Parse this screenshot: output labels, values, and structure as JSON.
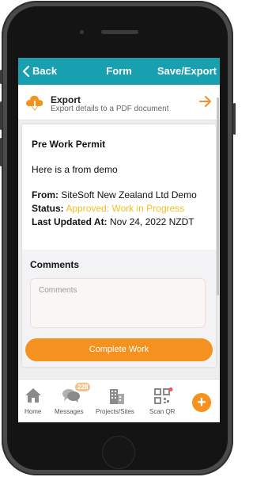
{
  "header": {
    "back_label": "Back",
    "title": "Form",
    "save_label": "Save/Export"
  },
  "export": {
    "title": "Export",
    "subtitle": "Export details to a PDF document"
  },
  "form": {
    "title": "Pre Work Permit",
    "description": "Here is a from demo",
    "from_label": "From:",
    "from_value": "SiteSoft New Zealand Ltd Demo",
    "status_label": "Status:",
    "status_value": "Approved: Work in Progress",
    "updated_label": "Last Updated At:",
    "updated_value": "Nov 24, 2022 NZDT"
  },
  "comments": {
    "label": "Comments",
    "placeholder": "Comments"
  },
  "complete_button": "Complete Work",
  "nav": {
    "home": "Home",
    "messages": "Messages",
    "messages_badge": "228",
    "projects": "Projects/Sites",
    "scan": "Scan QR",
    "add": "+"
  },
  "colors": {
    "teal": "#18a0b0",
    "orange": "#f5911e",
    "status_yellow": "#f2bf24"
  },
  "icons": [
    "chevron-left-icon",
    "cloud-download-icon",
    "arrow-right-icon",
    "home-icon",
    "chat-bubbles-icon",
    "buildings-icon",
    "qr-code-icon",
    "plus-icon"
  ]
}
